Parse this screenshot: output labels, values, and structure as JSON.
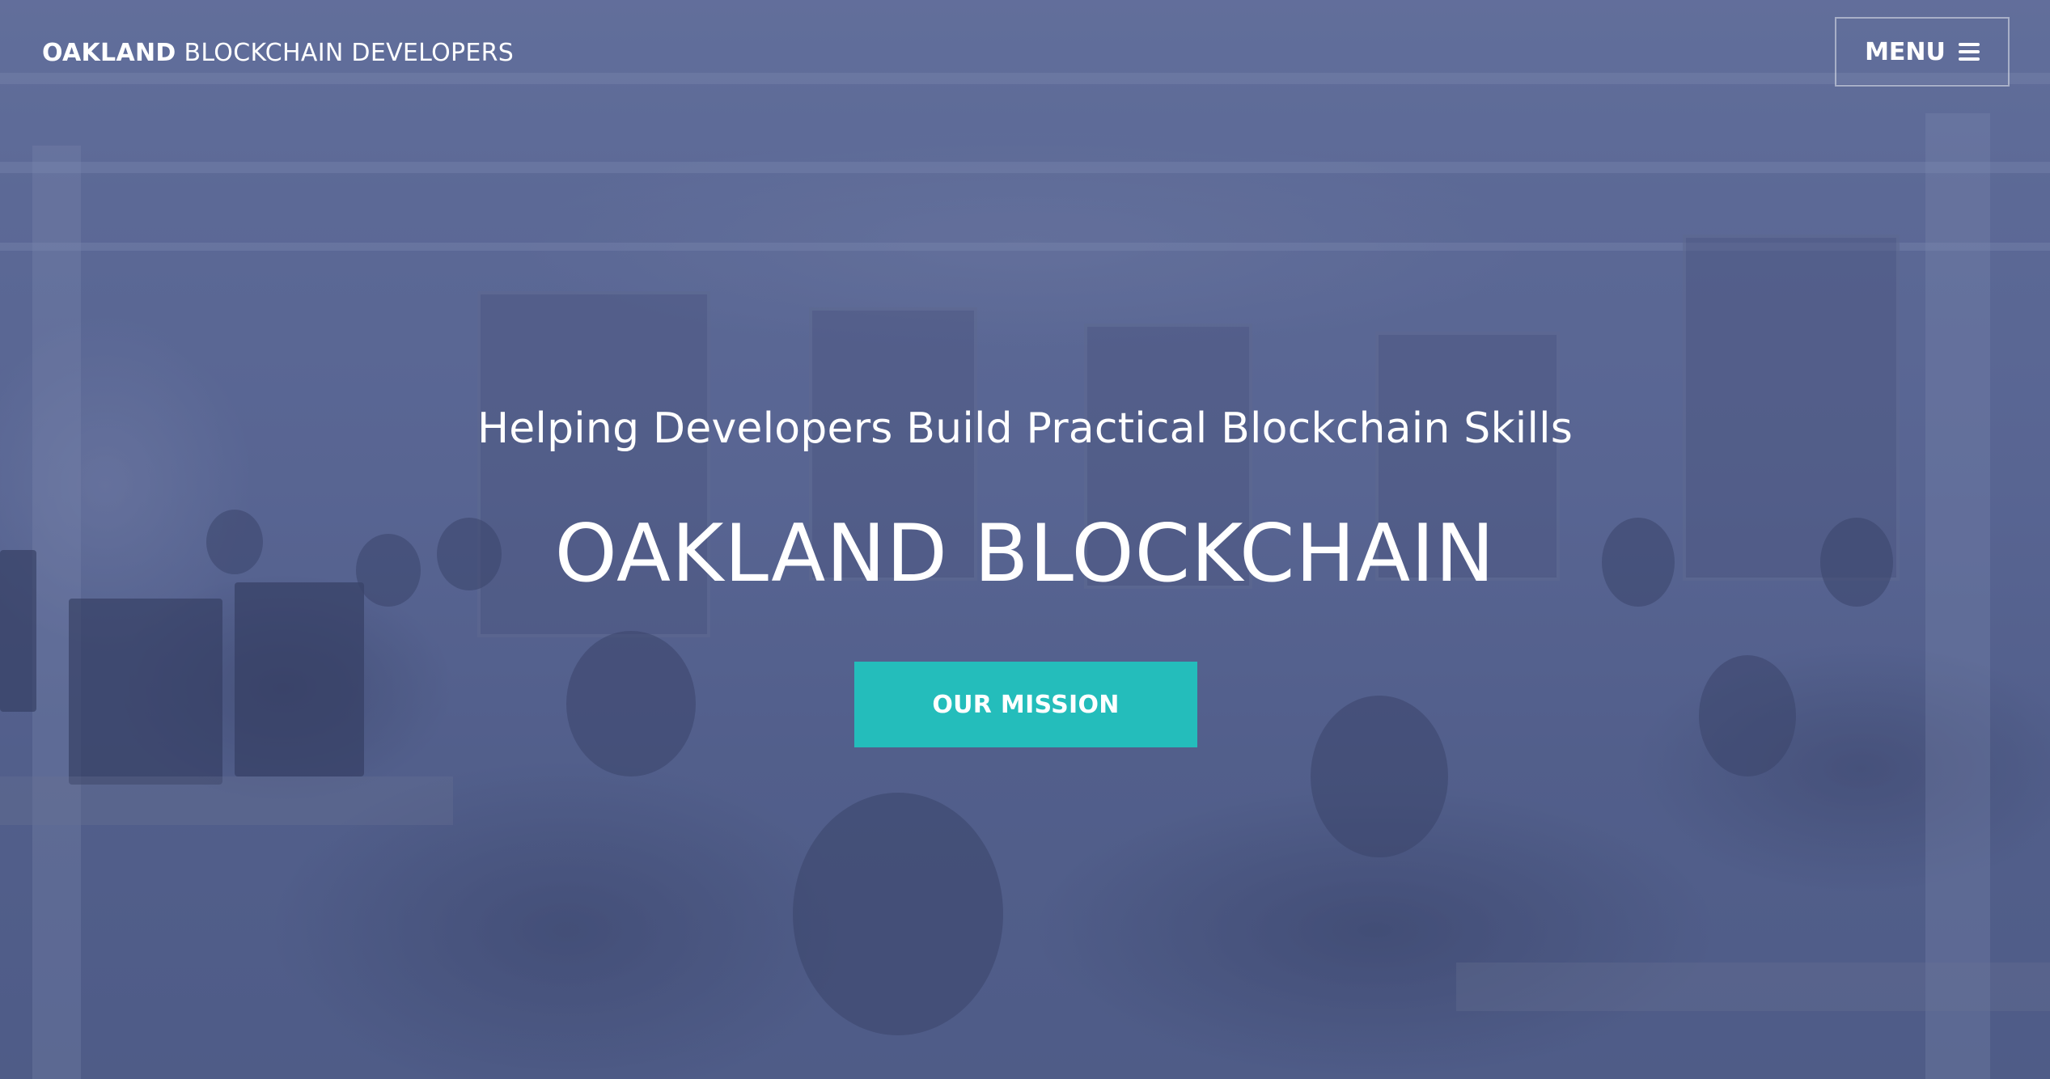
{
  "nav": {
    "brand_strong": "OAKLAND",
    "brand_light": "BLOCKCHAIN DEVELOPERS",
    "menu_label": "MENU",
    "menu_icon": "hamburger-icon"
  },
  "hero": {
    "subtitle": "Helping Developers Build Practical Blockchain Skills",
    "title": "OAKLAND BLOCKCHAIN",
    "cta_label": "OUR MISSION",
    "background_image": "blurred photo of developers working on laptops in a classroom"
  },
  "colors": {
    "overlay": "#56638d",
    "cta": "#24bdbb",
    "text": "#ffffff"
  }
}
